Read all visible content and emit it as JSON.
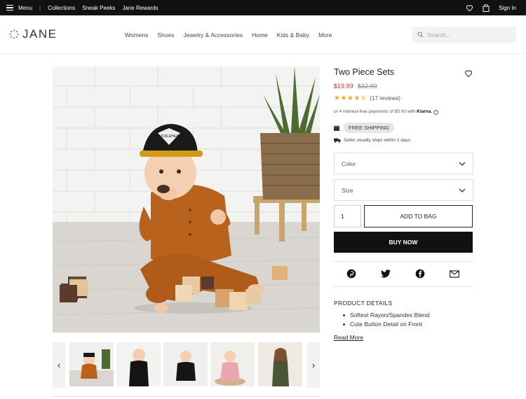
{
  "topbar": {
    "menu_label": "Menu",
    "links": [
      "Collections",
      "Sneak Peeks",
      "Jane Rewards"
    ],
    "sign_in": "Sign In"
  },
  "header": {
    "logo_text": "JANE",
    "nav": [
      "Womens",
      "Shoes",
      "Jewelry & Accessories",
      "Home",
      "Kids & Baby",
      "More"
    ],
    "search_placeholder": "Search..."
  },
  "product": {
    "title": "Two Piece Sets",
    "sale_price": "$19.99",
    "original_price": "$32.99",
    "rating_value": 4.5,
    "reviews": "(17 reviews)",
    "klarna_text": "or 4 interest-free payments of $5.00 with",
    "klarna_brand": "Klarna.",
    "shipping_badge": "FREE SHIPPING",
    "ships_text": "Seller usually ships within 2 days.",
    "color_label": "Color",
    "size_label": "Size",
    "quantity": "1",
    "add_to_bag": "ADD TO BAG",
    "buy_now": "BUY NOW",
    "details_title": "PRODUCT DETAILS",
    "details": [
      "Softest Rayon/Spandex Blend",
      "Cute Button Detail on Front"
    ],
    "read_more": "Read More"
  },
  "main_image": {
    "hat_text": "KNUCKLEHEADS"
  },
  "colors": {
    "accent_sale": "#c9302c",
    "star": "#f5a623",
    "topbar_bg": "#111111",
    "logo_dots": "#e0606a"
  },
  "icons": [
    "hamburger-icon",
    "heart-icon",
    "bag-icon",
    "search-icon",
    "box-icon",
    "truck-icon",
    "chevron-down-icon",
    "pinterest-icon",
    "twitter-icon",
    "facebook-icon",
    "email-icon",
    "chevron-left-icon",
    "chevron-right-icon",
    "info-icon"
  ]
}
